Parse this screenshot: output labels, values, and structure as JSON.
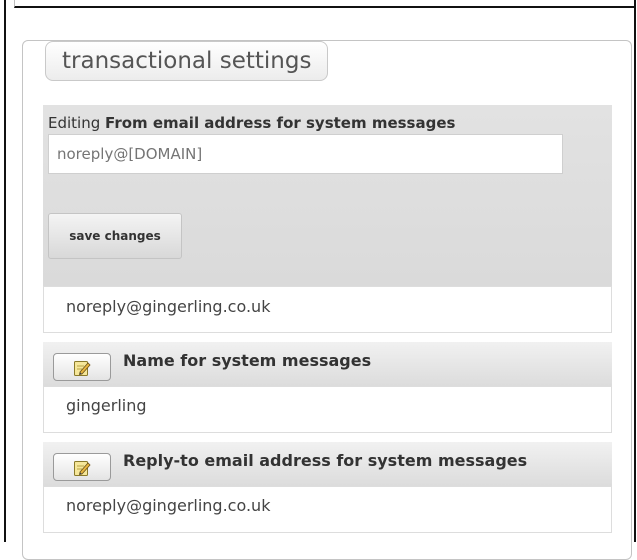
{
  "section": {
    "title": "transactional settings"
  },
  "from_email": {
    "editing_prefix": "Editing",
    "label": "From email address for system messages",
    "input_placeholder": "noreply@[DOMAIN]",
    "save_label": "save changes",
    "current_value": "noreply@gingerling.co.uk"
  },
  "settings": [
    {
      "label": "Name for system messages",
      "value": "gingerling",
      "icon": "pencil-notepad-icon"
    },
    {
      "label": "Reply-to email address for system messages",
      "value": "noreply@gingerling.co.uk",
      "icon": "pencil-notepad-icon"
    }
  ]
}
